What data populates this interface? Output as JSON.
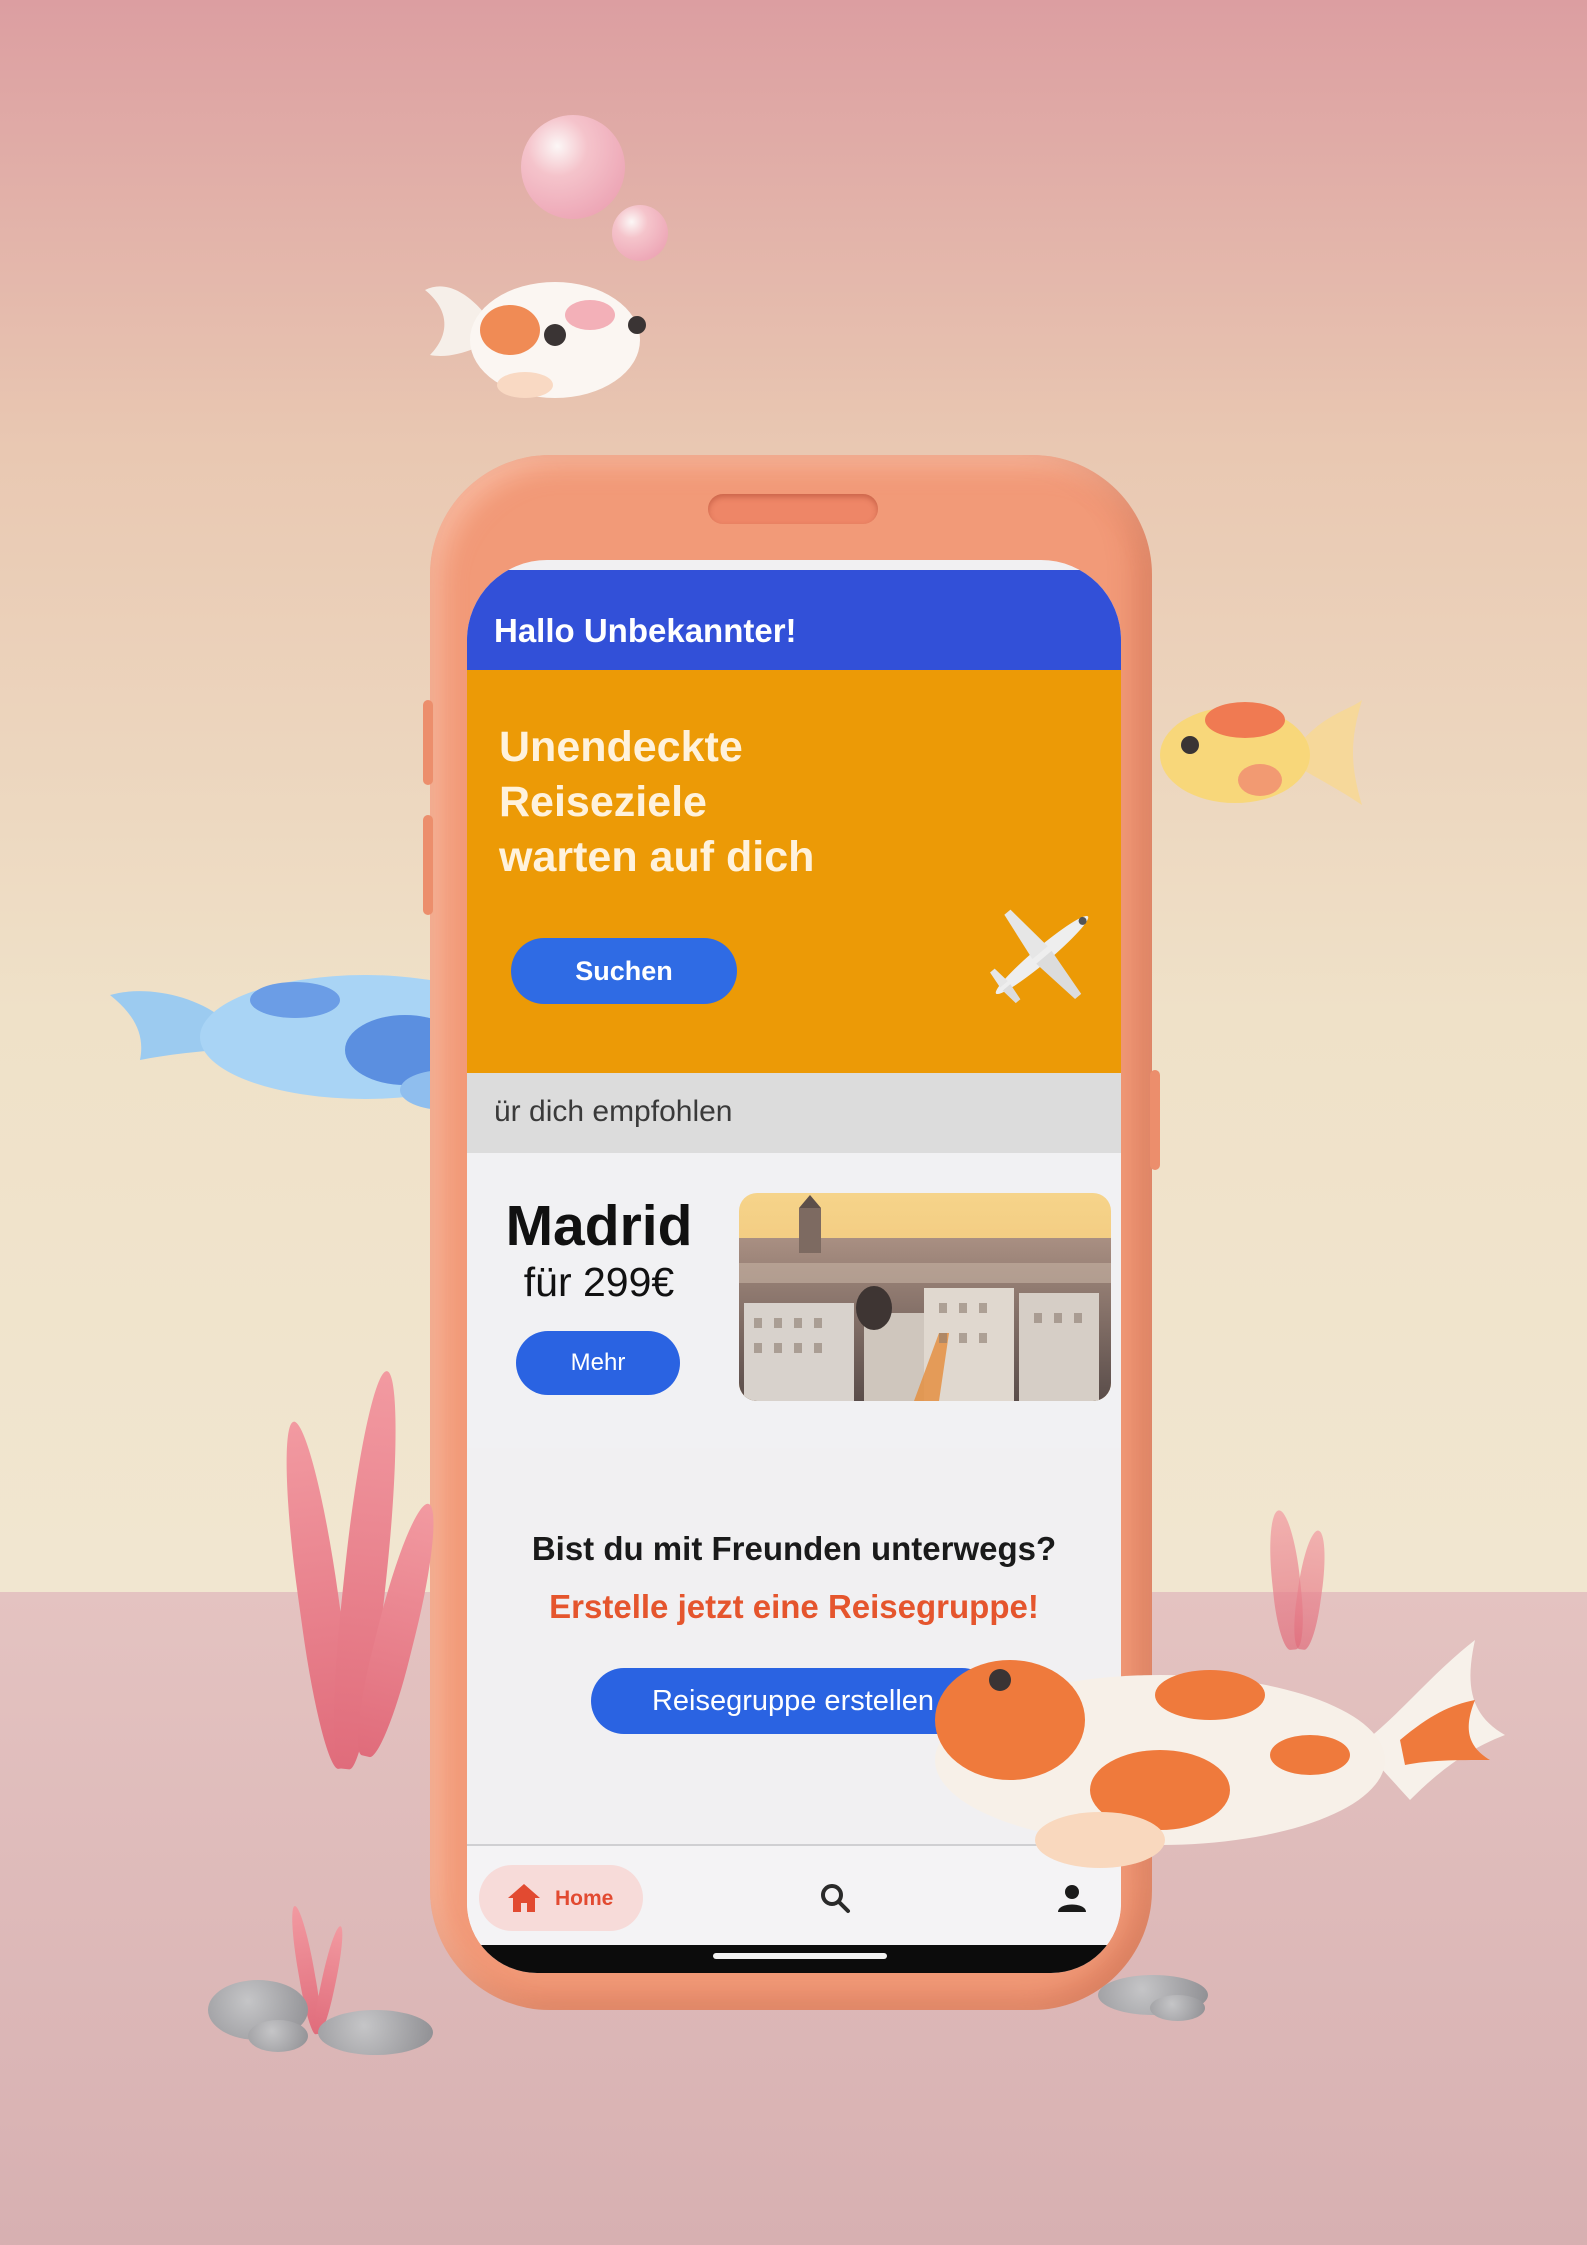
{
  "header": {
    "greeting": "Hallo Unbekannter!"
  },
  "hero": {
    "title_line_1": "Unendeckte",
    "title_line_2": "Reiseziele",
    "title_line_3": "warten auf dich",
    "search_button": "Suchen",
    "icon": "airplane-icon"
  },
  "section": {
    "label": "ür dich empfohlen"
  },
  "recommendation": {
    "city": "Madrid",
    "price": "für 299€",
    "more_button": "Mehr"
  },
  "group": {
    "question": "Bist du mit Freunden unterwegs?",
    "cta": "Erstelle jetzt eine Reisegruppe!",
    "button": "Reisegruppe erstellen"
  },
  "bottom_nav": {
    "home": {
      "label": "Home",
      "icon": "home-icon",
      "active": true
    },
    "search": {
      "icon": "search-icon"
    },
    "profile": {
      "icon": "person-icon"
    }
  },
  "colors": {
    "header_blue": "#3250d8",
    "hero_orange": "#ec9a06",
    "button_blue": "#2a63e2",
    "accent_red": "#e5552d",
    "phone_coral": "#f29a78"
  }
}
